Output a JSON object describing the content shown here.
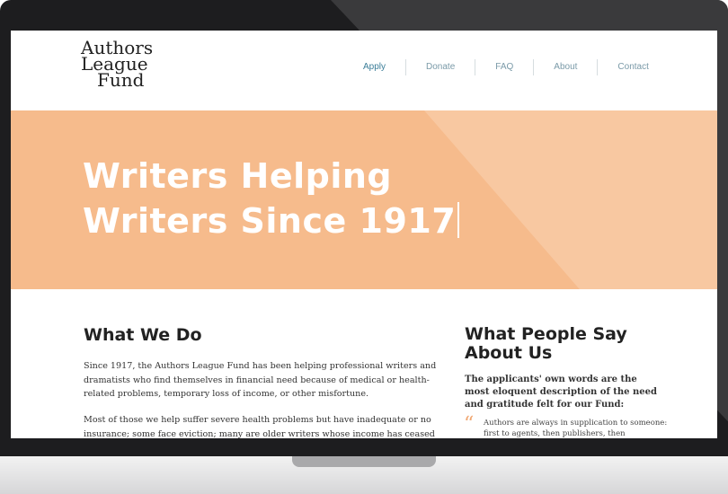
{
  "logo": {
    "line1": "Authors",
    "line2": "League",
    "line3": "Fund"
  },
  "nav": [
    {
      "label": "Apply"
    },
    {
      "label": "Donate"
    },
    {
      "label": "FAQ"
    },
    {
      "label": "About"
    },
    {
      "label": "Contact"
    }
  ],
  "hero": {
    "title": "Writers Helping Writers Since 1917"
  },
  "what_we_do": {
    "title": "What We Do",
    "para1": "Since 1917, the Authors League Fund has been helping professional writers and dramatists who find themselves in financial need because of medical or health-related problems, temporary loss of income, or other misfortune.",
    "para2": "Most of those we help suffer severe health problems but have inadequate or no insurance; some face eviction; many are older writers whose income has ceased"
  },
  "what_people_say": {
    "title": "What People Say About Us",
    "lead": "The applicants' own words are the most eloquent description of the need and gratitude felt for our Fund:",
    "quote_mark": "“",
    "quote": "Authors are always in supplication to someone: first to agents, then publishers, then reviewers,"
  },
  "colors": {
    "hero": "#f6bb8c",
    "hero_light": "#f8c8a1",
    "nav": "#7a9aa8",
    "nav_active": "#3b7d98",
    "quote_mark": "#f1a873"
  }
}
